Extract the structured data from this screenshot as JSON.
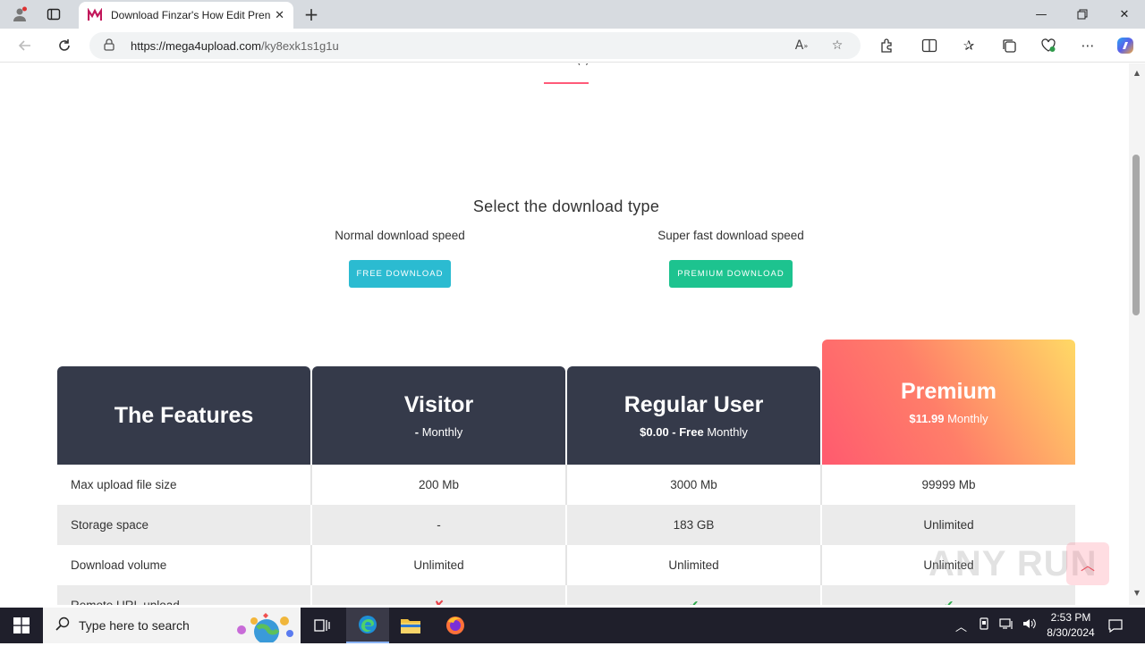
{
  "browser": {
    "tab_title": "Download Finzar's How Edit Pren",
    "url_host": "https://mega4upload.com",
    "url_path": "/ky8exk1s1g1u"
  },
  "page": {
    "top_fragment": "(              )",
    "select_title": "Select the download type",
    "normal": {
      "label": "Normal download speed",
      "button": "FREE DOWNLOAD"
    },
    "premium": {
      "label": "Super fast download speed",
      "button": "PREMIUM DOWNLOAD"
    },
    "plans": {
      "features": {
        "name": "The Features"
      },
      "visitor": {
        "name": "Visitor",
        "price": "-",
        "period": "Monthly"
      },
      "regular": {
        "name": "Regular User",
        "price": "$0.00 - Free",
        "period": "Monthly"
      },
      "premium": {
        "name": "Premium",
        "price": "$11.99",
        "period": "Monthly"
      }
    },
    "rows": [
      {
        "feature": "Max upload file size",
        "visitor": "200 Mb",
        "regular": "3000 Mb",
        "premium": "99999 Mb"
      },
      {
        "feature": "Storage space",
        "visitor": "-",
        "regular": "183 GB",
        "premium": "Unlimited"
      },
      {
        "feature": "Download volume",
        "visitor": "Unlimited",
        "regular": "Unlimited",
        "premium": "Unlimited"
      },
      {
        "feature": "Remote URL upload",
        "visitor": "✘",
        "regular": "✔",
        "premium": "✔"
      }
    ],
    "watermark": "ANY RUN"
  },
  "taskbar": {
    "search_placeholder": "Type here to search",
    "time": "2:53 PM",
    "date": "8/30/2024"
  },
  "colors": {
    "dark_header": "#353a4a",
    "free_button": "#2bbbd1",
    "premium_button": "#1dc38f",
    "accent": "#ff5a79"
  }
}
